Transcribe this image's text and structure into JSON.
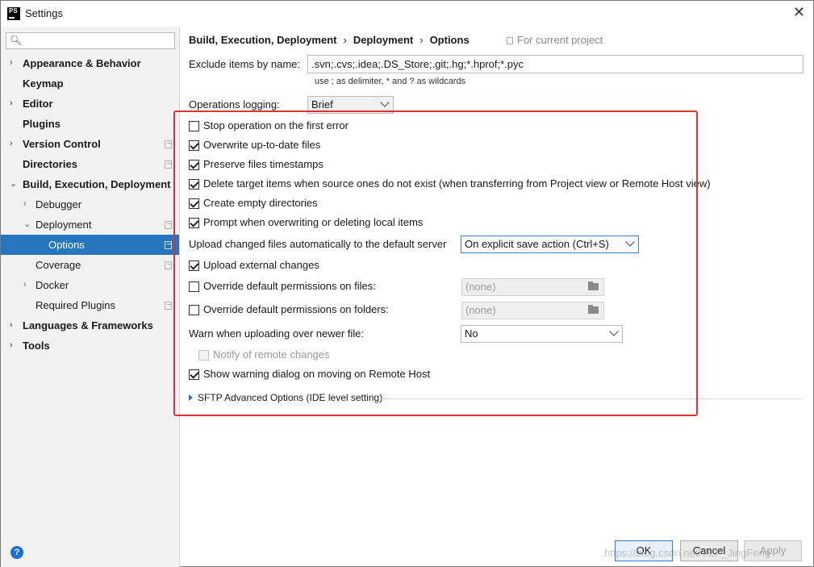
{
  "window": {
    "title": "Settings",
    "app_icon_text": "PS"
  },
  "sidebar": {
    "search_placeholder": "",
    "items": [
      {
        "label": "Appearance & Behavior",
        "arrow": "›"
      },
      {
        "label": "Keymap"
      },
      {
        "label": "Editor",
        "arrow": "›"
      },
      {
        "label": "Plugins"
      },
      {
        "label": "Version Control",
        "arrow": "›"
      },
      {
        "label": "Directories"
      },
      {
        "label": "Build, Execution, Deployment",
        "arrow": "⌄"
      },
      {
        "label": "Debugger",
        "arrow": "›"
      },
      {
        "label": "Deployment",
        "arrow": "⌄"
      },
      {
        "label": "Options"
      },
      {
        "label": "Coverage"
      },
      {
        "label": "Docker",
        "arrow": "›"
      },
      {
        "label": "Required Plugins"
      },
      {
        "label": "Languages & Frameworks",
        "arrow": "›"
      },
      {
        "label": "Tools",
        "arrow": "›"
      }
    ]
  },
  "breadcrumb": {
    "level1": "Build, Execution, Deployment",
    "level2": "Deployment",
    "level3": "Options",
    "separator": "›",
    "scope_note": "For current project"
  },
  "options": {
    "exclude_label": "Exclude items by name:",
    "exclude_value": ".svn;.cvs;.idea;.DS_Store;.git;.hg;*.hprof;*.pyc",
    "exclude_hint": "use ; as delimiter, * and ? as wildcards",
    "logging_label": "Operations logging:",
    "logging_value": "Brief",
    "stop_on_error": "Stop operation on the first error",
    "overwrite_up_to_date": "Overwrite up-to-date files",
    "preserve_timestamps": "Preserve files timestamps",
    "delete_target_items": "Delete target items when source ones do not exist (when transferring from Project view or Remote Host view)",
    "create_empty_dirs": "Create empty directories",
    "prompt_overwriting": "Prompt when overwriting or deleting local items",
    "upload_changed_label": "Upload changed files automatically to the default server",
    "upload_changed_value": "On explicit save action (Ctrl+S)",
    "upload_external": "Upload external changes",
    "override_files": "Override default permissions on files:",
    "override_files_value": "(none)",
    "override_folders": "Override default permissions on folders:",
    "override_folders_value": "(none)",
    "warn_newer_label": "Warn when uploading over newer file:",
    "warn_newer_value": "No",
    "notify_remote": "Notify of remote changes",
    "show_warning_dialog": "Show warning dialog on moving on Remote Host",
    "sftp_advanced": "SFTP Advanced Options (IDE level setting)"
  },
  "buttons": {
    "ok": "OK",
    "cancel": "Cancel",
    "apply": "Apply"
  },
  "help_label": "?",
  "watermark": "https://blog.csdn.net/TCF_JingFeng",
  "colors": {
    "selection": "#2675bf",
    "highlight_frame": "#e22f2f",
    "help": "#1a6fd8"
  }
}
